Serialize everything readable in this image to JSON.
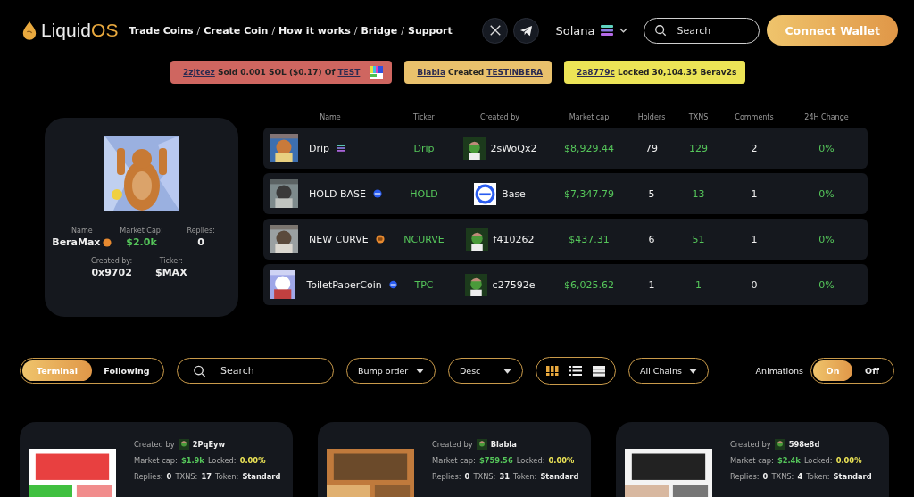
{
  "header": {
    "logo": {
      "prefix": "Liquid",
      "suffix": "OS"
    },
    "nav": [
      {
        "label": "Trade Coins"
      },
      {
        "label": "Create Coin"
      },
      {
        "label": "How it works"
      },
      {
        "label": "Bridge"
      },
      {
        "label": "Support"
      }
    ],
    "separator": "/",
    "chain": "Solana",
    "search": {
      "placeholder": "Search"
    },
    "connect": "Connect Wallet"
  },
  "tickers": [
    {
      "color": "#cf6660",
      "user": "2zJtcez",
      "action": "Sold 0.001 SOL ($0.17) Of",
      "token": "TEST"
    },
    {
      "color": "#e9c16c",
      "user": "Blabla",
      "action": "Created",
      "token": "TESTINBERA"
    },
    {
      "color": "#ece456",
      "user": "2a8779c",
      "action": "Locked 30,104.35 Berav2s"
    }
  ],
  "featured": {
    "chain": {
      "kind": "bera"
    },
    "stats": [
      {
        "label": "Name",
        "value": "BeraMax",
        "kind": "name"
      },
      {
        "label": "Market Cap:",
        "value": "$2.0k",
        "kind": "money"
      },
      {
        "label": "Replies:",
        "value": "0",
        "kind": "plain"
      },
      {
        "label": "Created by:",
        "value": "0x9702",
        "kind": "plain"
      },
      {
        "label": "Ticker:",
        "value": "$MAX",
        "kind": "plain"
      }
    ]
  },
  "table": {
    "columns": [
      "Name",
      "Ticker",
      "Created by",
      "Market cap",
      "Holders",
      "TXNS",
      "Comments",
      "24H Change"
    ],
    "rows": [
      {
        "name": "Drip",
        "chain": {
          "kind": "solana"
        },
        "ticker": "Drip",
        "creator": "2sWoQx2",
        "creator_avatar": {
          "kind": "frog"
        },
        "market_cap": "$8,929.44",
        "holders": "79",
        "txns": "129",
        "comments": "2",
        "change": "0%"
      },
      {
        "name": "HOLD BASE",
        "chain": {
          "kind": "base"
        },
        "ticker": "HOLD",
        "creator": "Base",
        "creator_avatar": {
          "kind": "base"
        },
        "market_cap": "$7,347.79",
        "holders": "5",
        "txns": "13",
        "comments": "1",
        "change": "0%"
      },
      {
        "name": "NEW CURVE",
        "chain": {
          "kind": "bera"
        },
        "ticker": "NCURVE",
        "creator": "f410262",
        "creator_avatar": {
          "kind": "frog"
        },
        "market_cap": "$437.31",
        "holders": "6",
        "txns": "51",
        "comments": "1",
        "change": "0%"
      },
      {
        "name": "ToiletPaperCoin",
        "chain": {
          "kind": "base"
        },
        "ticker": "TPC",
        "creator": "c27592e",
        "creator_avatar": {
          "kind": "frog"
        },
        "market_cap": "$6,025.62",
        "holders": "1",
        "txns": "1",
        "comments": "0",
        "change": "0%"
      }
    ]
  },
  "filters": {
    "tabs": [
      {
        "label": "Terminal",
        "selected": true
      },
      {
        "label": "Following",
        "selected": false
      }
    ],
    "search": {
      "placeholder": "Search"
    },
    "dropdowns": [
      {
        "label": "Bump order"
      },
      {
        "label": "Desc"
      }
    ],
    "views": [
      {
        "kind": "grid",
        "selected": true
      },
      {
        "kind": "list",
        "selected": false
      },
      {
        "kind": "table",
        "selected": false
      }
    ],
    "chains": {
      "label": "All Chains"
    },
    "animations": {
      "label": "Animations",
      "options": [
        {
          "label": "On",
          "selected": true
        },
        {
          "label": "Off",
          "selected": false
        }
      ]
    }
  },
  "cards": [
    {
      "creator_label": "Created by",
      "creator": "2PqEyw",
      "mc_label": "Market cap:",
      "mc": "$1.9k",
      "locked_label": "Locked:",
      "locked": "0.00%",
      "replies_label": "Replies:",
      "replies": "0",
      "txns_label": "TXNS:",
      "txns": "17",
      "token_label": "Token:",
      "token": "Standard"
    },
    {
      "creator_label": "Created by",
      "creator": "Blabla",
      "mc_label": "Market cap:",
      "mc": "$759.56",
      "locked_label": "Locked:",
      "locked": "0.00%",
      "replies_label": "Replies:",
      "replies": "0",
      "txns_label": "TXNS:",
      "txns": "31",
      "token_label": "Token:",
      "token": "Standard"
    },
    {
      "creator_label": "Created by",
      "creator": "598e8d",
      "mc_label": "Market cap:",
      "mc": "$2.4k",
      "locked_label": "Locked:",
      "locked": "0.00%",
      "replies_label": "Replies:",
      "replies": "0",
      "txns_label": "TXNS:",
      "txns": "4",
      "token_label": "Token:",
      "token": "Standard"
    }
  ]
}
